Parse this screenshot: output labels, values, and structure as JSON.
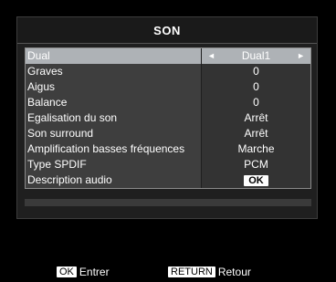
{
  "title": "SON",
  "menu": [
    {
      "label": "Dual",
      "value": "Dual1",
      "selected": true
    },
    {
      "label": "Graves",
      "value": "0"
    },
    {
      "label": "Aigus",
      "value": "0"
    },
    {
      "label": "Balance",
      "value": "0"
    },
    {
      "label": "Egalisation du son",
      "value": "Arrêt"
    },
    {
      "label": "Son surround",
      "value": "Arrêt"
    },
    {
      "label": "Amplification basses fréquences",
      "value": "Marche"
    },
    {
      "label": "Type SPDIF",
      "value": "PCM"
    },
    {
      "label": "Description audio",
      "value": "OK"
    }
  ],
  "icons": {
    "left": "◄",
    "right": "►"
  },
  "footer": {
    "ok_key": "OK",
    "ok_label": "Entrer",
    "return_key": "RETURN",
    "return_label": "Retour"
  }
}
